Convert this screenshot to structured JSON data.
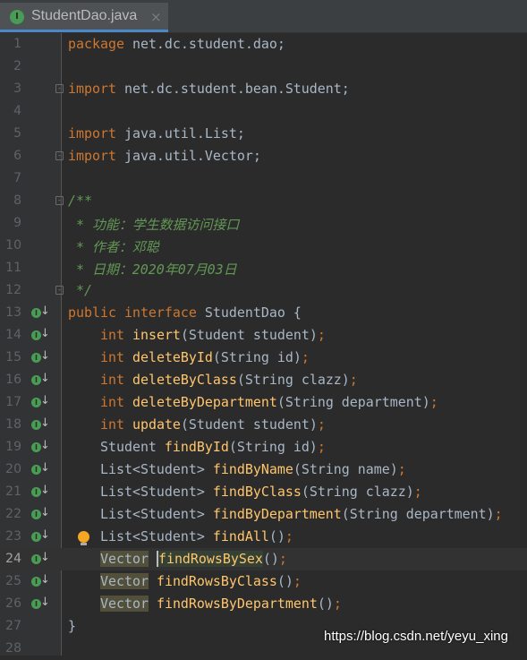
{
  "tab": {
    "title": "StudentDao.java",
    "icon": "interface-icon",
    "icon_letter": "I",
    "close": "×"
  },
  "colors": {
    "background": "#2b2b2b",
    "keyword": "#cc7832",
    "method": "#ffc66d",
    "plain": "#a9b7c6",
    "comment": "#629755",
    "accent": "#4a88c7"
  },
  "current_line": 24,
  "lines": [
    {
      "n": "1",
      "tokens": [
        {
          "t": "package ",
          "c": "kw"
        },
        {
          "t": "net.dc.student.dao;",
          "c": "pl"
        }
      ]
    },
    {
      "n": "2",
      "tokens": []
    },
    {
      "n": "3",
      "fold": true,
      "tokens": [
        {
          "t": "import ",
          "c": "kw"
        },
        {
          "t": "net.dc.student.bean.Student;",
          "c": "pl"
        }
      ]
    },
    {
      "n": "4",
      "tokens": []
    },
    {
      "n": "5",
      "tokens": [
        {
          "t": "import ",
          "c": "kw"
        },
        {
          "t": "java.util.List;",
          "c": "pl"
        }
      ]
    },
    {
      "n": "6",
      "fold": true,
      "tokens": [
        {
          "t": "import ",
          "c": "kw"
        },
        {
          "t": "java.util.Vector;",
          "c": "pl"
        }
      ]
    },
    {
      "n": "7",
      "tokens": []
    },
    {
      "n": "8",
      "fold": true,
      "tokens": [
        {
          "t": "/**",
          "c": "cm"
        }
      ]
    },
    {
      "n": "9",
      "tokens": [
        {
          "t": " * 功能：学生数据访问接口",
          "c": "cm"
        }
      ]
    },
    {
      "n": "10",
      "tokens": [
        {
          "t": " * 作者：邓聪",
          "c": "cm"
        }
      ]
    },
    {
      "n": "11",
      "tokens": [
        {
          "t": " * 日期：2020年07月03日",
          "c": "cm"
        }
      ]
    },
    {
      "n": "12",
      "fold": true,
      "tokens": [
        {
          "t": " */",
          "c": "cm"
        }
      ]
    },
    {
      "n": "13",
      "impl": true,
      "tokens": [
        {
          "t": "public interface ",
          "c": "kw"
        },
        {
          "t": "StudentDao {",
          "c": "pl"
        }
      ]
    },
    {
      "n": "14",
      "impl": true,
      "tokens": [
        {
          "t": "    ",
          "c": "pl"
        },
        {
          "t": "int ",
          "c": "kw"
        },
        {
          "t": "insert",
          "c": "fn"
        },
        {
          "t": "(Student student)",
          "c": "pl"
        },
        {
          "t": ";",
          "c": "kw"
        }
      ]
    },
    {
      "n": "15",
      "impl": true,
      "tokens": [
        {
          "t": "    ",
          "c": "pl"
        },
        {
          "t": "int ",
          "c": "kw"
        },
        {
          "t": "deleteById",
          "c": "fn"
        },
        {
          "t": "(String id)",
          "c": "pl"
        },
        {
          "t": ";",
          "c": "kw"
        }
      ]
    },
    {
      "n": "16",
      "impl": true,
      "tokens": [
        {
          "t": "    ",
          "c": "pl"
        },
        {
          "t": "int ",
          "c": "kw"
        },
        {
          "t": "deleteByClass",
          "c": "fn"
        },
        {
          "t": "(String clazz)",
          "c": "pl"
        },
        {
          "t": ";",
          "c": "kw"
        }
      ]
    },
    {
      "n": "17",
      "impl": true,
      "tokens": [
        {
          "t": "    ",
          "c": "pl"
        },
        {
          "t": "int ",
          "c": "kw"
        },
        {
          "t": "deleteByDepartment",
          "c": "fn"
        },
        {
          "t": "(String department)",
          "c": "pl"
        },
        {
          "t": ";",
          "c": "kw"
        }
      ]
    },
    {
      "n": "18",
      "impl": true,
      "tokens": [
        {
          "t": "    ",
          "c": "pl"
        },
        {
          "t": "int ",
          "c": "kw"
        },
        {
          "t": "update",
          "c": "fn"
        },
        {
          "t": "(Student student)",
          "c": "pl"
        },
        {
          "t": ";",
          "c": "kw"
        }
      ]
    },
    {
      "n": "19",
      "impl": true,
      "tokens": [
        {
          "t": "    Student ",
          "c": "pl"
        },
        {
          "t": "findById",
          "c": "fn"
        },
        {
          "t": "(String id)",
          "c": "pl"
        },
        {
          "t": ";",
          "c": "kw"
        }
      ]
    },
    {
      "n": "20",
      "impl": true,
      "tokens": [
        {
          "t": "    List<Student> ",
          "c": "pl"
        },
        {
          "t": "findByName",
          "c": "fn"
        },
        {
          "t": "(String name)",
          "c": "pl"
        },
        {
          "t": ";",
          "c": "kw"
        }
      ]
    },
    {
      "n": "21",
      "impl": true,
      "tokens": [
        {
          "t": "    List<Student> ",
          "c": "pl"
        },
        {
          "t": "findByClass",
          "c": "fn"
        },
        {
          "t": "(String clazz)",
          "c": "pl"
        },
        {
          "t": ";",
          "c": "kw"
        }
      ]
    },
    {
      "n": "22",
      "impl": true,
      "tokens": [
        {
          "t": "    List<Student> ",
          "c": "pl"
        },
        {
          "t": "findByDepartment",
          "c": "fn"
        },
        {
          "t": "(String department)",
          "c": "pl"
        },
        {
          "t": ";",
          "c": "kw"
        }
      ]
    },
    {
      "n": "23",
      "impl": true,
      "bulb": true,
      "tokens": [
        {
          "t": "    List<Student> ",
          "c": "pl"
        },
        {
          "t": "findAll",
          "c": "fn"
        },
        {
          "t": "()",
          "c": "pl"
        },
        {
          "t": ";",
          "c": "kw"
        }
      ]
    },
    {
      "n": "24",
      "impl": true,
      "tokens": [
        {
          "t": "    ",
          "c": "pl"
        },
        {
          "t": "Vector",
          "c": "pl hl"
        },
        {
          "t": " ",
          "c": "pl"
        },
        {
          "t": "findRowsBySex",
          "c": "fn hl2 caret"
        },
        {
          "t": "()",
          "c": "pl"
        },
        {
          "t": ";",
          "c": "kw"
        }
      ]
    },
    {
      "n": "25",
      "impl": true,
      "tokens": [
        {
          "t": "    ",
          "c": "pl"
        },
        {
          "t": "Vector",
          "c": "pl hl"
        },
        {
          "t": " ",
          "c": "pl"
        },
        {
          "t": "findRowsByClass",
          "c": "fn"
        },
        {
          "t": "()",
          "c": "pl"
        },
        {
          "t": ";",
          "c": "kw"
        }
      ]
    },
    {
      "n": "26",
      "impl": true,
      "tokens": [
        {
          "t": "    ",
          "c": "pl"
        },
        {
          "t": "Vector",
          "c": "pl hl"
        },
        {
          "t": " ",
          "c": "pl"
        },
        {
          "t": "findRowsByDepartment",
          "c": "fn"
        },
        {
          "t": "()",
          "c": "pl"
        },
        {
          "t": ";",
          "c": "kw"
        }
      ]
    },
    {
      "n": "27",
      "tokens": [
        {
          "t": "}",
          "c": "pl"
        }
      ]
    },
    {
      "n": "28",
      "tokens": []
    }
  ],
  "watermark": "https://blog.csdn.net/yeyu_xing"
}
